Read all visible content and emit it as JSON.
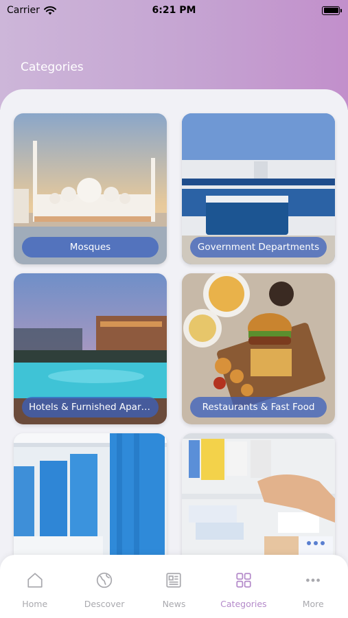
{
  "status_bar": {
    "carrier": "Carrier",
    "time": "6:21 PM"
  },
  "header": {
    "title": "Categories"
  },
  "categories": [
    {
      "label": "Mosques"
    },
    {
      "label": "Government Departments"
    },
    {
      "label": "Hotels & Furnished Apartm..."
    },
    {
      "label": "Restaurants & Fast Food"
    },
    {
      "label": ""
    },
    {
      "label": ""
    }
  ],
  "tabs": [
    {
      "label": "Home",
      "icon": "home-icon"
    },
    {
      "label": "Descover",
      "icon": "globe-icon"
    },
    {
      "label": "News",
      "icon": "newspaper-icon"
    },
    {
      "label": "Categories",
      "icon": "grid-icon",
      "active": true
    },
    {
      "label": "More",
      "icon": "more-icon"
    }
  ],
  "colors": {
    "accent": "#b389c9",
    "label_bg": "#3a60be",
    "inactive": "#a9a9ae"
  }
}
